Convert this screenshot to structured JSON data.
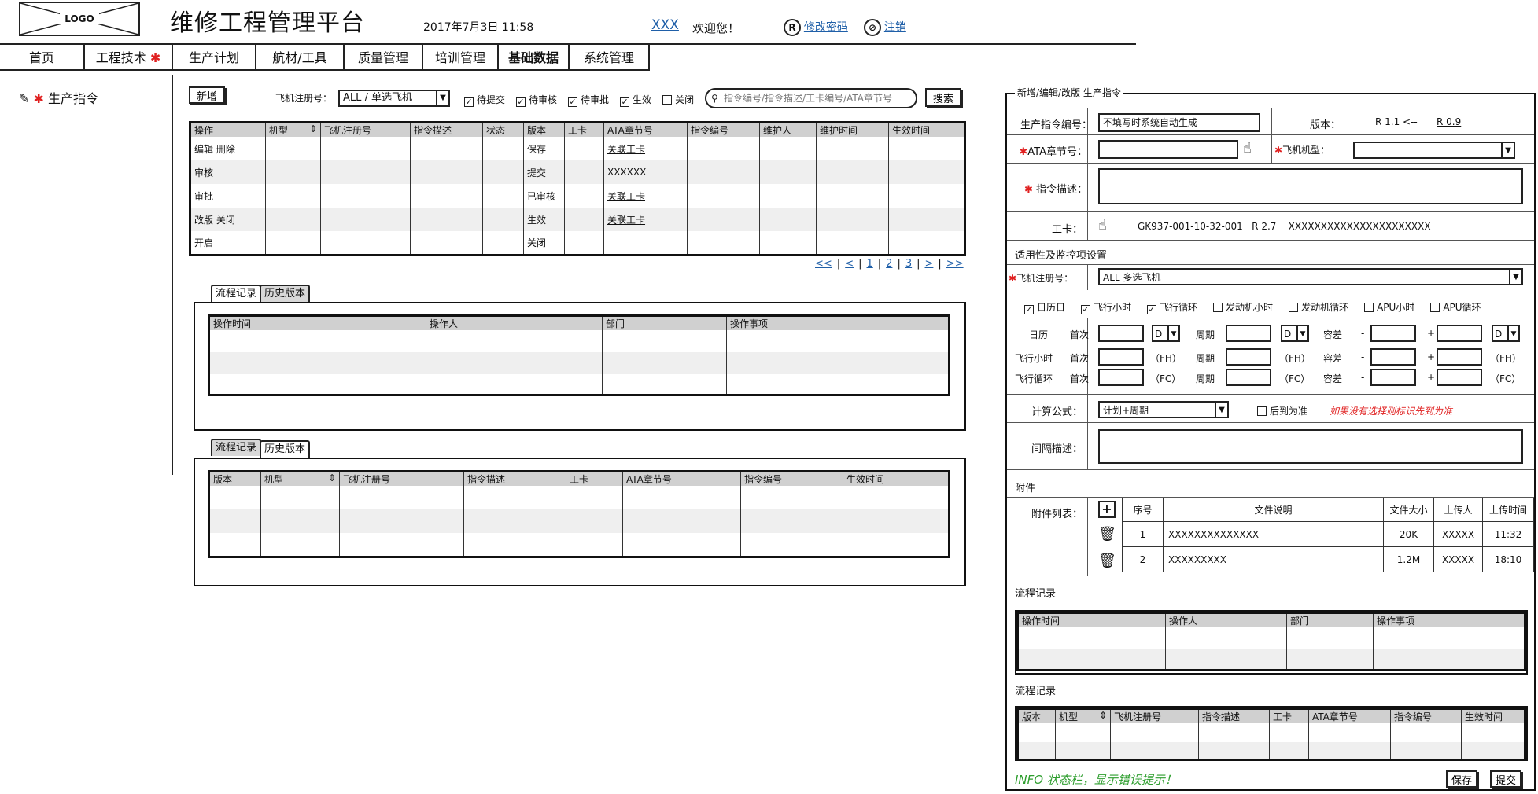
{
  "header": {
    "logo": "LOGO",
    "title": "维修工程管理平台",
    "datetime": "2017年7月3日 11:58",
    "user": "XXX",
    "welcome": "欢迎您！",
    "change_pwd_icon": "R",
    "change_pwd": "修改密码",
    "logout": "注销"
  },
  "nav": [
    "首页",
    "工程技术",
    "生产计划",
    "航材/工具",
    "质量管理",
    "培训管理",
    "基础数据",
    "系统管理"
  ],
  "nav_star": "✱",
  "sidebar": {
    "item": "生产指令",
    "star": "✱"
  },
  "toolbar": {
    "add": "新增",
    "reg_label": "飞机注册号：",
    "reg_value": "ALL / 单选飞机",
    "filters": [
      "待提交",
      "待审核",
      "待审批",
      "生效",
      "关闭"
    ],
    "filter_checked": [
      true,
      true,
      true,
      true,
      false
    ],
    "search_placeholder": "指令编号/指令描述/工卡编号/ATA章节号",
    "search_btn": "搜索"
  },
  "main_table": {
    "headers": [
      "操作",
      "机型",
      "飞机注册号",
      "指令描述",
      "状态",
      "版本",
      "工卡",
      "ATA章节号",
      "指令编号",
      "维护人",
      "维护时间",
      "生效时间"
    ],
    "rows": [
      [
        "编辑 删除",
        "",
        "",
        "",
        "",
        "保存",
        "",
        "关联工卡",
        "",
        "",
        "",
        ""
      ],
      [
        "审核",
        "",
        "",
        "",
        "",
        "提交",
        "",
        "XXXXXX",
        "",
        "",
        "",
        ""
      ],
      [
        "审批",
        "",
        "",
        "",
        "",
        "已审核",
        "",
        "关联工卡",
        "",
        "",
        "",
        ""
      ],
      [
        "改版 关闭",
        "",
        "",
        "",
        "",
        "生效",
        "",
        "关联工卡",
        "",
        "",
        "",
        ""
      ],
      [
        "开启",
        "",
        "",
        "",
        "",
        "关闭",
        "",
        "",
        "",
        "",
        "",
        ""
      ]
    ]
  },
  "pagination": [
    "<<",
    "<",
    "1",
    "2",
    "3",
    ">",
    ">>"
  ],
  "tabs1": {
    "active": "流程记录",
    "other": "历史版本",
    "headers": [
      "操作时间",
      "操作人",
      "部门",
      "操作事项"
    ]
  },
  "tabs2": {
    "active": "历史版本",
    "other": "流程记录",
    "headers": [
      "版本",
      "机型",
      "飞机注册号",
      "指令描述",
      "工卡",
      "ATA章节号",
      "指令编号",
      "生效时间"
    ]
  },
  "form": {
    "legend": "新增/编辑/改版 生产指令",
    "code_label": "生产指令编号：",
    "code_value": "不填写时系统自动生成",
    "ver_label": "版本：",
    "ver_value": "R 1.1 <--",
    "ver_link": "R 0.9",
    "ata_label": "ATA章节号：",
    "type_label": "飞机机型：",
    "desc_label": "指令描述：",
    "card_label": "工卡：",
    "card_value": "GK937-001-10-32-001   R 2.7    XXXXXXXXXXXXXXXXXXXXXX",
    "app_title": "适用性及监控项设置",
    "reg_label": "飞机注册号：",
    "reg_value": "ALL 多选飞机",
    "monitor": [
      "日历日",
      "飞行小时",
      "飞行循环",
      "发动机小时",
      "发动机循环",
      "APU小时",
      "APU循环"
    ],
    "monitor_checked": [
      true,
      true,
      true,
      false,
      false,
      false,
      false
    ],
    "rows": [
      {
        "label": "日历",
        "unit": "D"
      },
      {
        "label": "飞行小时",
        "unit": "（FH）"
      },
      {
        "label": "飞行循环",
        "unit": "（FC）"
      }
    ],
    "first": "首次",
    "period": "周期",
    "tol": "容差",
    "minus": "-",
    "plus": "+",
    "formula_label": "计算公式：",
    "formula_value": "计划+周期",
    "later_label": "后到为准",
    "formula_hint": "如果没有选择则标识先到为准",
    "interval_label": "间隔描述：",
    "attach_title": "附件",
    "attach_list": "附件列表：",
    "attach_headers": [
      "序号",
      "文件说明",
      "文件大小",
      "上传人",
      "上传时间"
    ],
    "attach_rows": [
      [
        "1",
        "XXXXXXXXXXXXXX",
        "20K",
        "XXXXX",
        "11:32"
      ],
      [
        "2",
        "XXXXXXXXX",
        "1.2M",
        "XXXXX",
        "18:10"
      ]
    ],
    "flow_title": "流程记录",
    "flow_headers": [
      "操作时间",
      "操作人",
      "部门",
      "操作事项"
    ],
    "hist_title": "流程记录",
    "hist_headers": [
      "版本",
      "机型",
      "飞机注册号",
      "指令描述",
      "工卡",
      "ATA章节号",
      "指令编号",
      "生效时间"
    ],
    "info": "INFO 状态栏，显示错误提示！",
    "save": "保存",
    "submit": "提交"
  }
}
